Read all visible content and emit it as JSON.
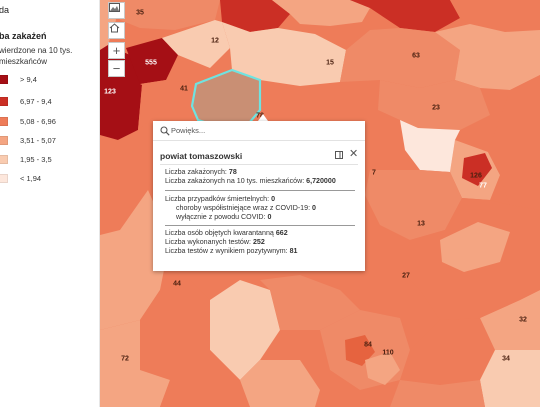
{
  "legend": {
    "header": "da",
    "layer_title": "ba zakażeń",
    "subtitle_line1": "wierdzone na 10 tys.",
    "subtitle_line2": "mieszkańców",
    "classes": [
      {
        "label": "> 9,4",
        "color": "#a50f15"
      },
      {
        "label": "6,97 - 9,4",
        "color": "#cb2f25"
      },
      {
        "label": "5,08 - 6,96",
        "color": "#ee7c59"
      },
      {
        "label": "3,51 - 5,07",
        "color": "#f4a582"
      },
      {
        "label": "1,95 - 3,5",
        "color": "#f9cbb0"
      },
      {
        "label": "< 1,94",
        "color": "#fde7dc"
      }
    ]
  },
  "map": {
    "selected_color": "#c98f74",
    "highlight_color": "#6fe3e0",
    "numbers": [
      {
        "text": "35",
        "cls": ""
      },
      {
        "text": "12",
        "cls": ""
      },
      {
        "text": "555",
        "cls": "light"
      },
      {
        "text": "15",
        "cls": ""
      },
      {
        "text": "63",
        "cls": ""
      },
      {
        "text": "123",
        "cls": "light"
      },
      {
        "text": "41",
        "cls": ""
      },
      {
        "text": "78",
        "cls": ""
      },
      {
        "text": "23",
        "cls": ""
      },
      {
        "text": "7",
        "cls": ""
      },
      {
        "text": "126",
        "cls": ""
      },
      {
        "text": "77",
        "cls": "light"
      },
      {
        "text": "13",
        "cls": ""
      },
      {
        "text": "27",
        "cls": ""
      },
      {
        "text": "44",
        "cls": ""
      },
      {
        "text": "32",
        "cls": ""
      },
      {
        "text": "84",
        "cls": ""
      },
      {
        "text": "110",
        "cls": ""
      },
      {
        "text": "72",
        "cls": ""
      },
      {
        "text": "34",
        "cls": ""
      }
    ]
  },
  "controls": {
    "basemap_icon": "basemap-icon",
    "home_icon": "home-icon",
    "zoom_in": "+",
    "zoom_out": "−"
  },
  "popup": {
    "search_placeholder": "Powięks...",
    "title": "powiat tomaszowski",
    "close_icon": "close-icon",
    "dock_icon": "dock-icon",
    "cases_label": "Liczba zakażonych:",
    "cases_value": "78",
    "per10k_label": "Liczba zakażonych na 10 tys. mieszkańców:",
    "per10k_value": "6,720000",
    "deaths_label": "Liczba przypadków śmiertelnych:",
    "deaths_value": "0",
    "comorb_label": "choroby współistniejące wraz z COVID-19:",
    "comorb_value": "0",
    "covid_only_label": "wyłącznie z powodu COVID:",
    "covid_only_value": "0",
    "quarantine_label": "Liczba osób objętych kwarantanną",
    "quarantine_value": "662",
    "tests_label": "Liczba wykonanych testów:",
    "tests_value": "252",
    "positive_label": "Liczba testów z wynikiem pozytywnym:",
    "positive_value": "81"
  }
}
